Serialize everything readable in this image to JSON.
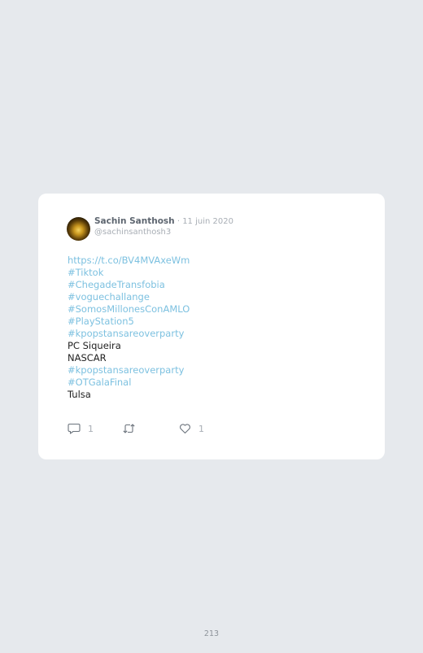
{
  "tweet": {
    "author_name": "Sachin Santhosh",
    "separator": " · ",
    "date": "11 juin 2020",
    "handle": "@sachinsanthosh3",
    "lines": [
      {
        "text": "https://t.co/BV4MVAxeWm",
        "kind": "link"
      },
      {
        "text": "#Tiktok",
        "kind": "link"
      },
      {
        "text": "#ChegadeTransfobia",
        "kind": "link"
      },
      {
        "text": "#voguechallange",
        "kind": "link"
      },
      {
        "text": "#SomosMillonesConAMLO",
        "kind": "link"
      },
      {
        "text": "#PlayStation5",
        "kind": "link"
      },
      {
        "text": "#kpopstansareoverparty",
        "kind": "link"
      },
      {
        "text": "PC Siqueira",
        "kind": "plain"
      },
      {
        "text": "NASCAR",
        "kind": "plain"
      },
      {
        "text": "#kpopstansareoverparty",
        "kind": "link"
      },
      {
        "text": "#OTGalaFinal",
        "kind": "link"
      },
      {
        "text": "Tulsa",
        "kind": "plain"
      }
    ],
    "actions": {
      "reply_count": "1",
      "retweet_count": "",
      "like_count": "1"
    }
  },
  "footer": {
    "page_number": "213"
  },
  "colors": {
    "background": "#e6e9ed",
    "card": "#ffffff",
    "link": "#7dc1e0",
    "muted": "#a8aeb5"
  },
  "icons": {
    "reply": "speech-bubble-icon",
    "retweet": "retweet-icon",
    "like": "heart-icon"
  }
}
